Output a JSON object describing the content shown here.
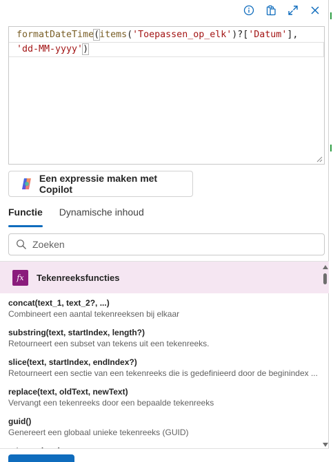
{
  "toolbar": {
    "icons": [
      "info-icon",
      "clipboard-icon",
      "expand-icon",
      "close-icon"
    ],
    "accent": "#0f6cbd"
  },
  "editor": {
    "tokens_line1": [
      {
        "t": "formatDateTime",
        "k": "fn"
      },
      {
        "t": "(",
        "k": "brk"
      },
      {
        "t": "items",
        "k": "fn"
      },
      {
        "t": "(",
        "k": "pn"
      },
      {
        "t": "'Toepassen_op_elk'",
        "k": "str"
      },
      {
        "t": ")?[",
        "k": "pn"
      },
      {
        "t": "'Datum'",
        "k": "str"
      },
      {
        "t": "],",
        "k": "pn"
      }
    ],
    "tokens_line2": [
      {
        "t": "'dd-MM-yyyy'",
        "k": "str"
      },
      {
        "t": ")",
        "k": "brk"
      }
    ]
  },
  "copilot": {
    "label": "Een expressie maken met Copilot"
  },
  "tabs": [
    {
      "label": "Functie",
      "active": true
    },
    {
      "label": "Dynamische inhoud",
      "active": false
    }
  ],
  "search": {
    "placeholder": "Zoeken",
    "value": ""
  },
  "category": {
    "icon_text": "fx",
    "label": "Tekenreeksfuncties",
    "color": "#8a1c7c"
  },
  "functions": [
    {
      "sig": "concat(text_1, text_2?, ...)",
      "desc": "Combineert een aantal tekenreeksen bij elkaar"
    },
    {
      "sig": "substring(text, startIndex, length?)",
      "desc": "Retourneert een subset van tekens uit een tekenreeks."
    },
    {
      "sig": "slice(text, startIndex, endIndex?)",
      "desc": "Retourneert een sectie van een tekenreeks die is gedefinieerd door de beginindex ..."
    },
    {
      "sig": "replace(text, oldText, newText)",
      "desc": "Vervangt een tekenreeks door een bepaalde tekenreeks"
    },
    {
      "sig": "guid()",
      "desc": "Genereert een globaal unieke tekenreeks (GUID)"
    },
    {
      "sig": "toLower(text)",
      "desc": ""
    }
  ]
}
